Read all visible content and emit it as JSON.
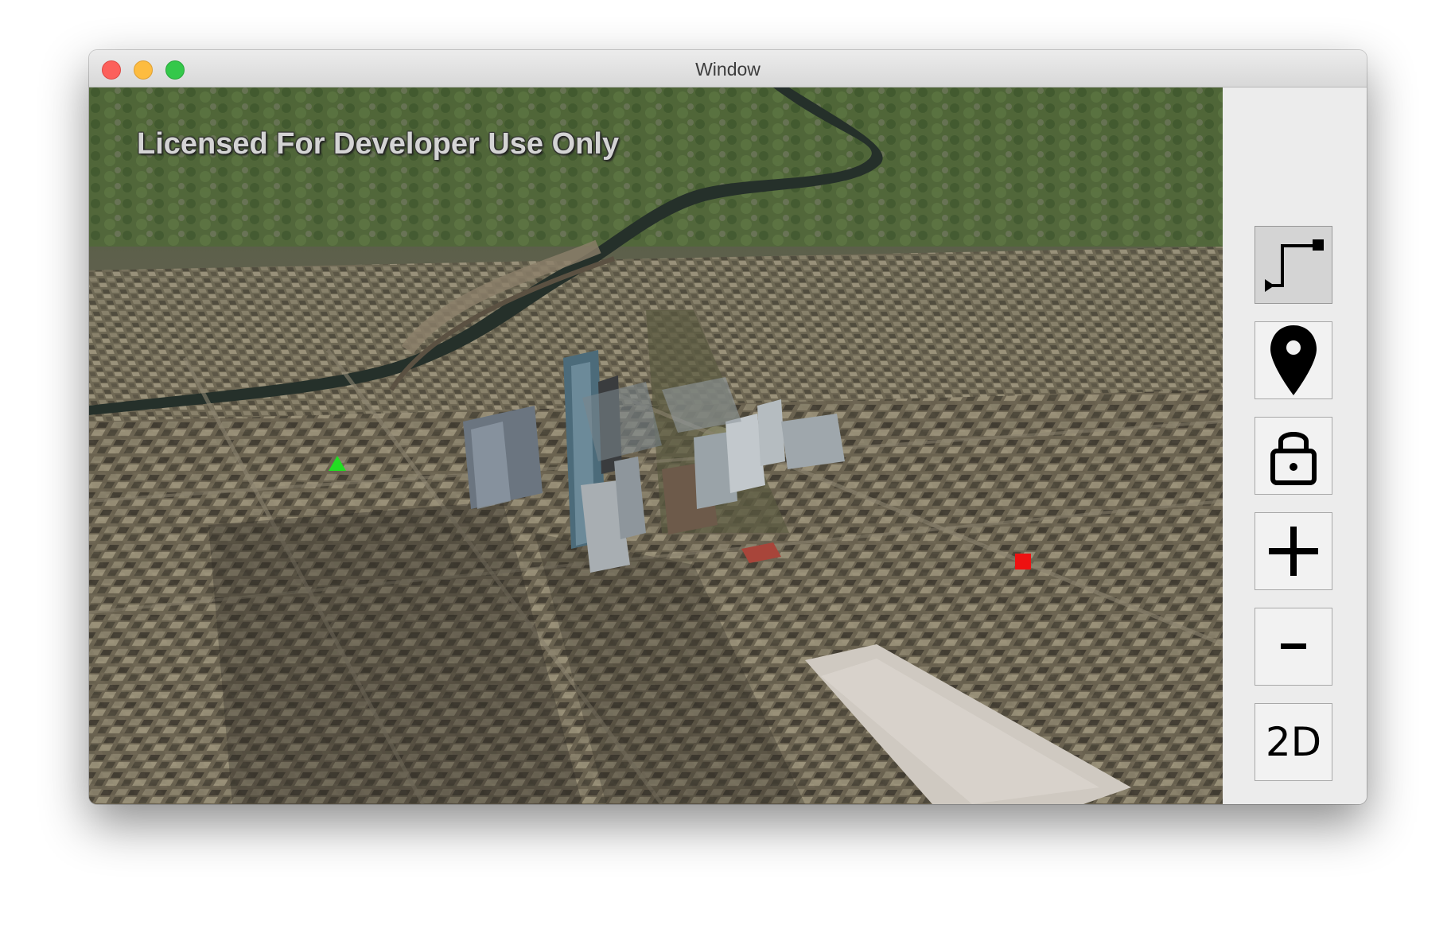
{
  "window": {
    "title": "Window"
  },
  "map": {
    "watermark": "Licensed For Developer Use Only",
    "graphics": [
      {
        "shape": "triangle",
        "color": "#22dd22"
      },
      {
        "shape": "square",
        "color": "#ee1111"
      }
    ]
  },
  "toolbar": {
    "buttons": [
      {
        "name": "route",
        "icon": "route-icon",
        "active": true
      },
      {
        "name": "place",
        "icon": "map-pin-icon"
      },
      {
        "name": "lock",
        "icon": "lock-icon"
      },
      {
        "name": "zoom-in",
        "label": "+"
      },
      {
        "name": "zoom-out",
        "label": "-"
      },
      {
        "name": "view-mode",
        "label": "2D"
      }
    ]
  }
}
